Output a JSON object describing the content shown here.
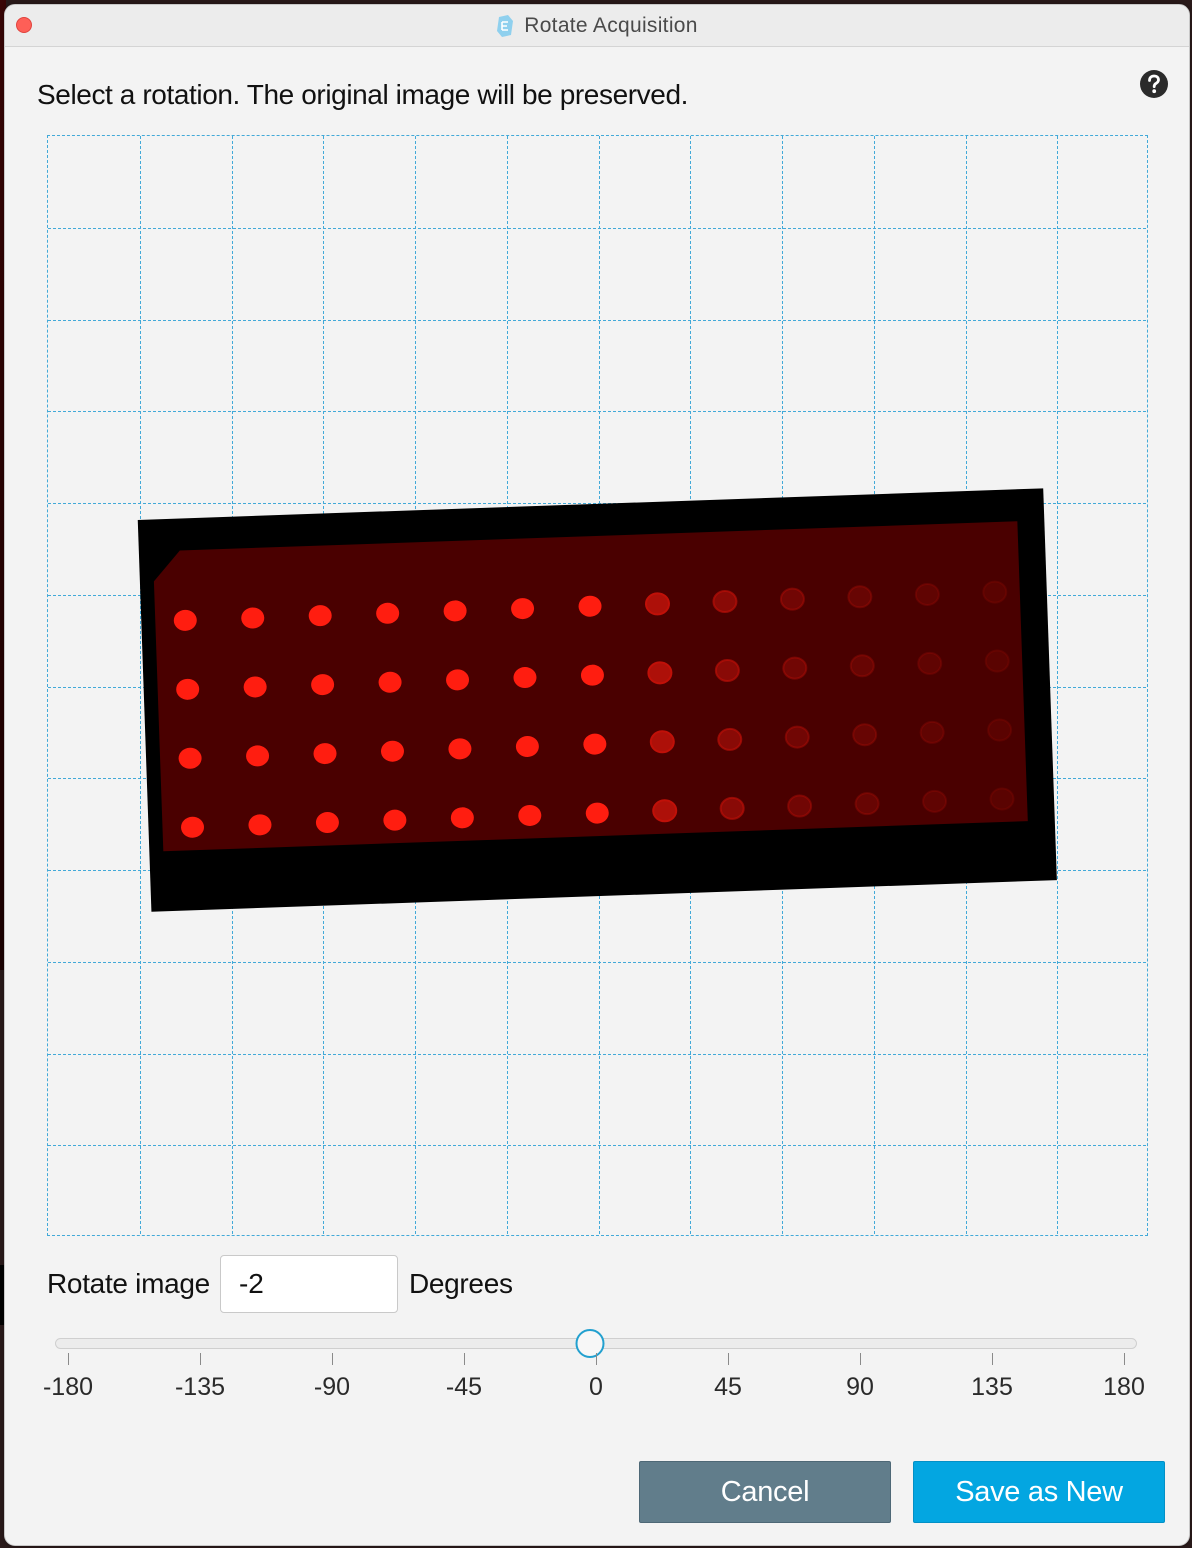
{
  "window": {
    "title": "Rotate Acquisition"
  },
  "dialog": {
    "instruction": "Select a rotation. The original image will be preserved."
  },
  "rotation": {
    "label": "Rotate image",
    "value": "-2",
    "unit_label": "Degrees",
    "slider": {
      "min": -180,
      "max": 180,
      "current": -2,
      "tick_labels": [
        "-180",
        "-135",
        "-90",
        "-45",
        "0",
        "45",
        "90",
        "135",
        "180"
      ]
    }
  },
  "buttons": {
    "cancel": "Cancel",
    "save_as_new": "Save as New"
  },
  "preview": {
    "grid_cells": 12,
    "spot_color": "#ff1d10",
    "membrane_color": "#4a0000"
  },
  "colors": {
    "accent": "#03a6e1",
    "cancel": "#617d8b",
    "grid": "#42a9d8"
  }
}
